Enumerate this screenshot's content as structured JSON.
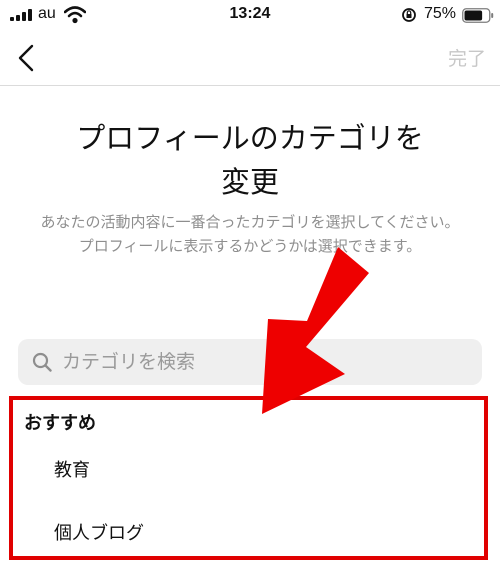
{
  "status_bar": {
    "carrier": "au",
    "time": "13:24",
    "battery_percent": "75%",
    "battery_level": 0.75
  },
  "nav": {
    "back_icon": "chevron-left-icon",
    "done_label": "完了"
  },
  "header": {
    "title_line1": "プロフィールのカテゴリを",
    "title_line2": "変更",
    "description": "あなたの活動内容に一番合ったカテゴリを選択してください。プロフィールに表示するかどうかは選択できます。"
  },
  "search": {
    "placeholder": "カテゴリを検索",
    "value": ""
  },
  "recommended": {
    "header": "おすすめ",
    "items": [
      {
        "label": "教育"
      },
      {
        "label": "個人ブログ"
      }
    ]
  },
  "annotation": {
    "highlight_color": "#e00000",
    "arrow_color": "#ee0000"
  }
}
